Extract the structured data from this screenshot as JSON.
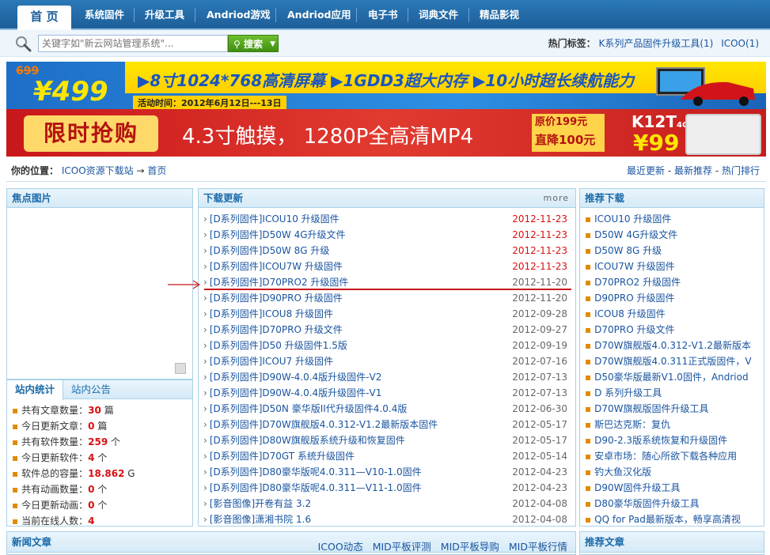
{
  "nav": {
    "home": "首 页",
    "items": [
      "系统固件",
      "升级工具",
      "Andriod游戏",
      "Andriod应用",
      "电子书",
      "词典文件",
      "精品影视"
    ]
  },
  "search": {
    "placeholder": "关键字如\"新云网站管理系统\"...",
    "button": "搜索",
    "hot_label": "热门标签：",
    "hot_tags": [
      "K系列产品固件升级工具(1)",
      "ICOO(1)"
    ]
  },
  "banner1": {
    "old_price": "699",
    "new_price": "¥499",
    "headline": "▶8寸1024*768高清屏幕 ▶1GDD3超大内存 ▶10小时超长续航能力",
    "time": "活动时间：2012年6月12日---13日"
  },
  "banner2": {
    "tag": "限时抢购",
    "slogan": "4.3寸触摸， 1280P全高清MP4",
    "price_orig": "原价199元",
    "price_drop": "直降100元",
    "model": "K12T",
    "model_sub": "4GB",
    "price": "¥99"
  },
  "breadcrumb": {
    "label": "你的位置：",
    "site": "ICOO资源下载站",
    "arrow": "→",
    "current": "首页",
    "right_links": [
      "最近更新",
      "最新推荐",
      "热门排行"
    ],
    "right_sep": " - "
  },
  "focus": {
    "title": "焦点图片"
  },
  "stats": {
    "tabs": [
      "站内统计",
      "站内公告"
    ],
    "items": [
      {
        "label": "共有文章数量：",
        "value": "30",
        "unit": "篇"
      },
      {
        "label": "今日更新文章：",
        "value": "0",
        "unit": "篇"
      },
      {
        "label": "共有软件数量：",
        "value": "259",
        "unit": "个"
      },
      {
        "label": "今日更新软件：",
        "value": "4",
        "unit": "个"
      },
      {
        "label": "软件总的容量：",
        "value": "18.862",
        "unit": "G"
      },
      {
        "label": "共有动画数量：",
        "value": "0",
        "unit": "个"
      },
      {
        "label": "今日更新动画：",
        "value": "0",
        "unit": "个"
      },
      {
        "label": "当前在线人数：",
        "value": "4",
        "unit": ""
      }
    ]
  },
  "downloads": {
    "title": "下载更新",
    "more": "more",
    "items": [
      {
        "title": "[D系列固件]ICOU10 升级固件",
        "date": "2012-11-23",
        "new": true
      },
      {
        "title": "[D系列固件]D50W 4G升级文件",
        "date": "2012-11-23",
        "new": true
      },
      {
        "title": "[D系列固件]D50W 8G 升级",
        "date": "2012-11-23",
        "new": true
      },
      {
        "title": "[D系列固件]ICOU7W 升级固件",
        "date": "2012-11-23",
        "new": true
      },
      {
        "title": "[D系列固件]D70PRO2 升级固件",
        "date": "2012-11-20",
        "new": false
      },
      {
        "title": "[D系列固件]D90PRO 升级固件",
        "date": "2012-11-20",
        "new": false
      },
      {
        "title": "[D系列固件]ICOU8 升级固件",
        "date": "2012-09-28",
        "new": false
      },
      {
        "title": "[D系列固件]D70PRO 升级文件",
        "date": "2012-09-27",
        "new": false
      },
      {
        "title": "[D系列固件]D50 升级固件1.5版",
        "date": "2012-09-19",
        "new": false
      },
      {
        "title": "[D系列固件]ICOU7 升级固件",
        "date": "2012-07-16",
        "new": false
      },
      {
        "title": "[D系列固件]D90W-4.0.4版升级固件-V2",
        "date": "2012-07-13",
        "new": false
      },
      {
        "title": "[D系列固件]D90W-4.0.4版升级固件-V1",
        "date": "2012-07-13",
        "new": false
      },
      {
        "title": "[D系列固件]D50N 豪华版II代升级固件4.0.4版",
        "date": "2012-06-30",
        "new": false
      },
      {
        "title": "[D系列固件]D70W旗舰版4.0.312-V1.2最新版本固件",
        "date": "2012-05-17",
        "new": false
      },
      {
        "title": "[D系列固件]D80W旗舰版系统升级和恢复固件",
        "date": "2012-05-17",
        "new": false
      },
      {
        "title": "[D系列固件]D70GT 系统升级固件",
        "date": "2012-05-14",
        "new": false
      },
      {
        "title": "[D系列固件]D80豪华版呢4.0.311—V10-1.0固件",
        "date": "2012-04-23",
        "new": false
      },
      {
        "title": "[D系列固件]D80豪华版呢4.0.311—V11-1.0固件",
        "date": "2012-04-23",
        "new": false
      },
      {
        "title": "[影音图像]开卷有益 3.2",
        "date": "2012-04-08",
        "new": false
      },
      {
        "title": "[影音图像]潇湘书院 1.6",
        "date": "2012-04-08",
        "new": false
      }
    ]
  },
  "recommend": {
    "title": "推荐下载",
    "items": [
      "ICOU10 升级固件",
      "D50W 4G升级文件",
      "D50W 8G 升级",
      "ICOU7W 升级固件",
      "D70PRO2 升级固件",
      "D90PRO 升级固件",
      "ICOU8 升级固件",
      "D70PRO 升级文件",
      "D70W旗舰版4.0.312-V1.2最新版本",
      "D70W旗舰版4.0.311正式版固件，V",
      "D50豪华版最新V1.0固件，Andriod",
      "D 系列升级工具",
      "D70W旗舰版固件升级工具",
      "斯巴达克斯：复仇",
      "D90-2.3版系统恢复和升级固件",
      "安卓市场：随心所欲下载各种应用",
      "钓大鱼汉化版",
      "D90W固件升级工具",
      "D80豪华版固件升级工具",
      "QQ for Pad最新版本，畅享高清视"
    ]
  },
  "news": {
    "title": "新闻文章",
    "links": [
      "ICOO动态",
      "MID平板评测",
      "MID平板导购",
      "MID平板行情"
    ]
  },
  "recart": {
    "title": "推荐文章"
  },
  "colors": {
    "nav": "#1d5f99",
    "accent_red": "#d81010",
    "panel_border": "#a9d1ea",
    "link": "#1a55a0"
  }
}
